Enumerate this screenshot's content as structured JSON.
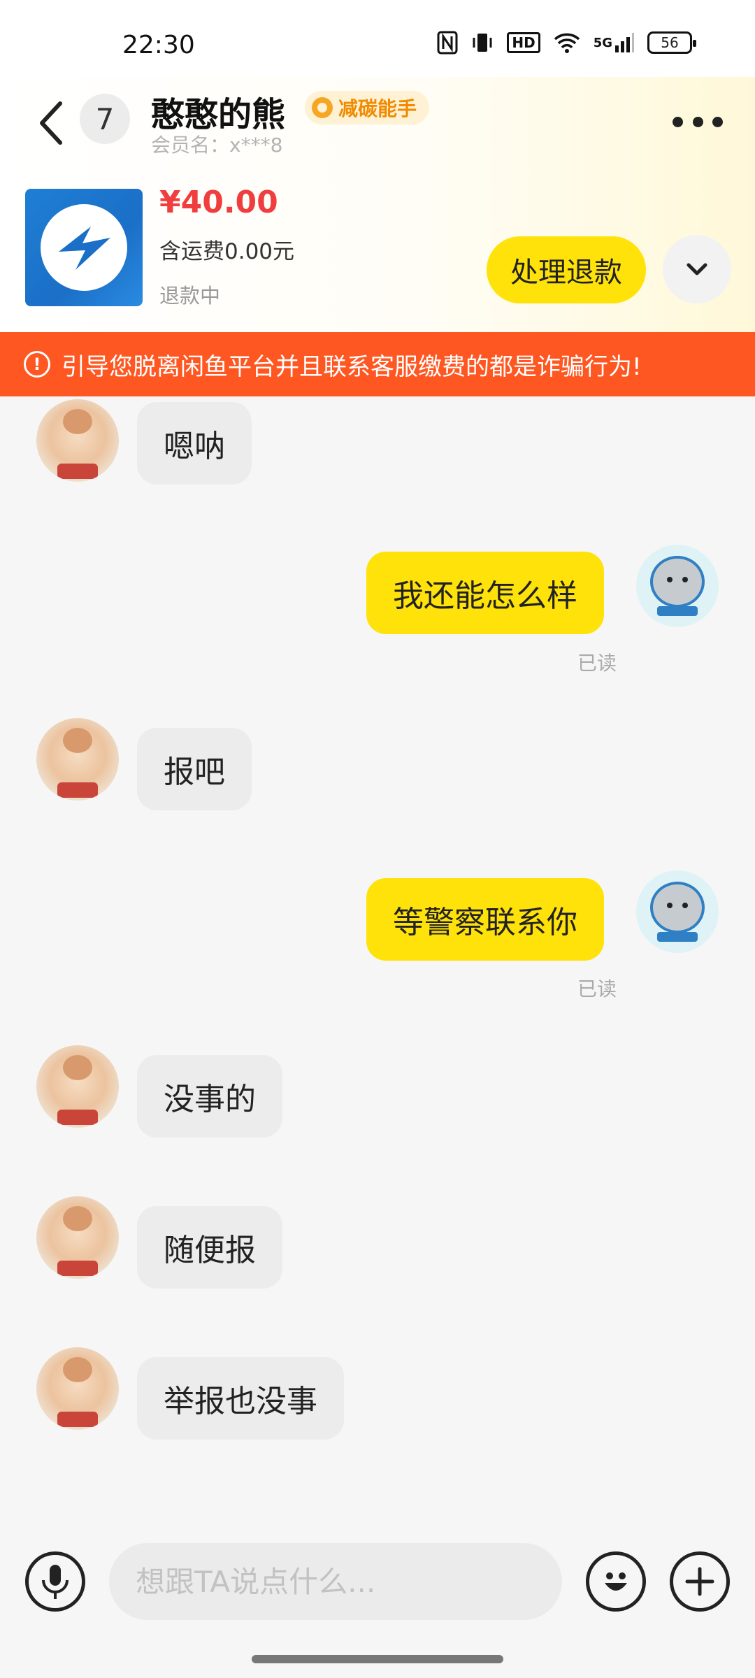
{
  "status_bar": {
    "time": "22:30",
    "icons": [
      "nfc-icon",
      "vibrate-icon",
      "hd-icon",
      "wifi-icon",
      "signal-5g-icon",
      "battery-icon"
    ],
    "hd_label": "HD",
    "net_label": "5G",
    "battery": "56"
  },
  "header": {
    "unread_count": "7",
    "contact_name": "憨憨的熊",
    "tag": "减碳能手",
    "member_name": "会员名：x***8"
  },
  "product": {
    "price": "¥40.00",
    "shipping": "含运费0.00元",
    "status": "退款中",
    "refund_button": "处理退款"
  },
  "warning": {
    "text": "引导您脱离闲鱼平台并且联系客服缴费的都是诈骗行为!"
  },
  "messages": [
    {
      "side": "in",
      "text": "嗯呐"
    },
    {
      "side": "out",
      "text": "我还能怎么样",
      "read": "已读"
    },
    {
      "side": "in",
      "text": "报吧"
    },
    {
      "side": "out",
      "text": "等警察联系你",
      "read": "已读"
    },
    {
      "side": "in",
      "text": "没事的"
    },
    {
      "side": "in",
      "text": "随便报"
    },
    {
      "side": "in",
      "text": "举报也没事"
    }
  ],
  "input": {
    "placeholder": "想跟TA说点什么..."
  },
  "colors": {
    "accent_yellow": "#ffe20a",
    "warning_orange": "#ff5722",
    "price_red": "#f03d3d",
    "tag_orange": "#f08a00"
  }
}
